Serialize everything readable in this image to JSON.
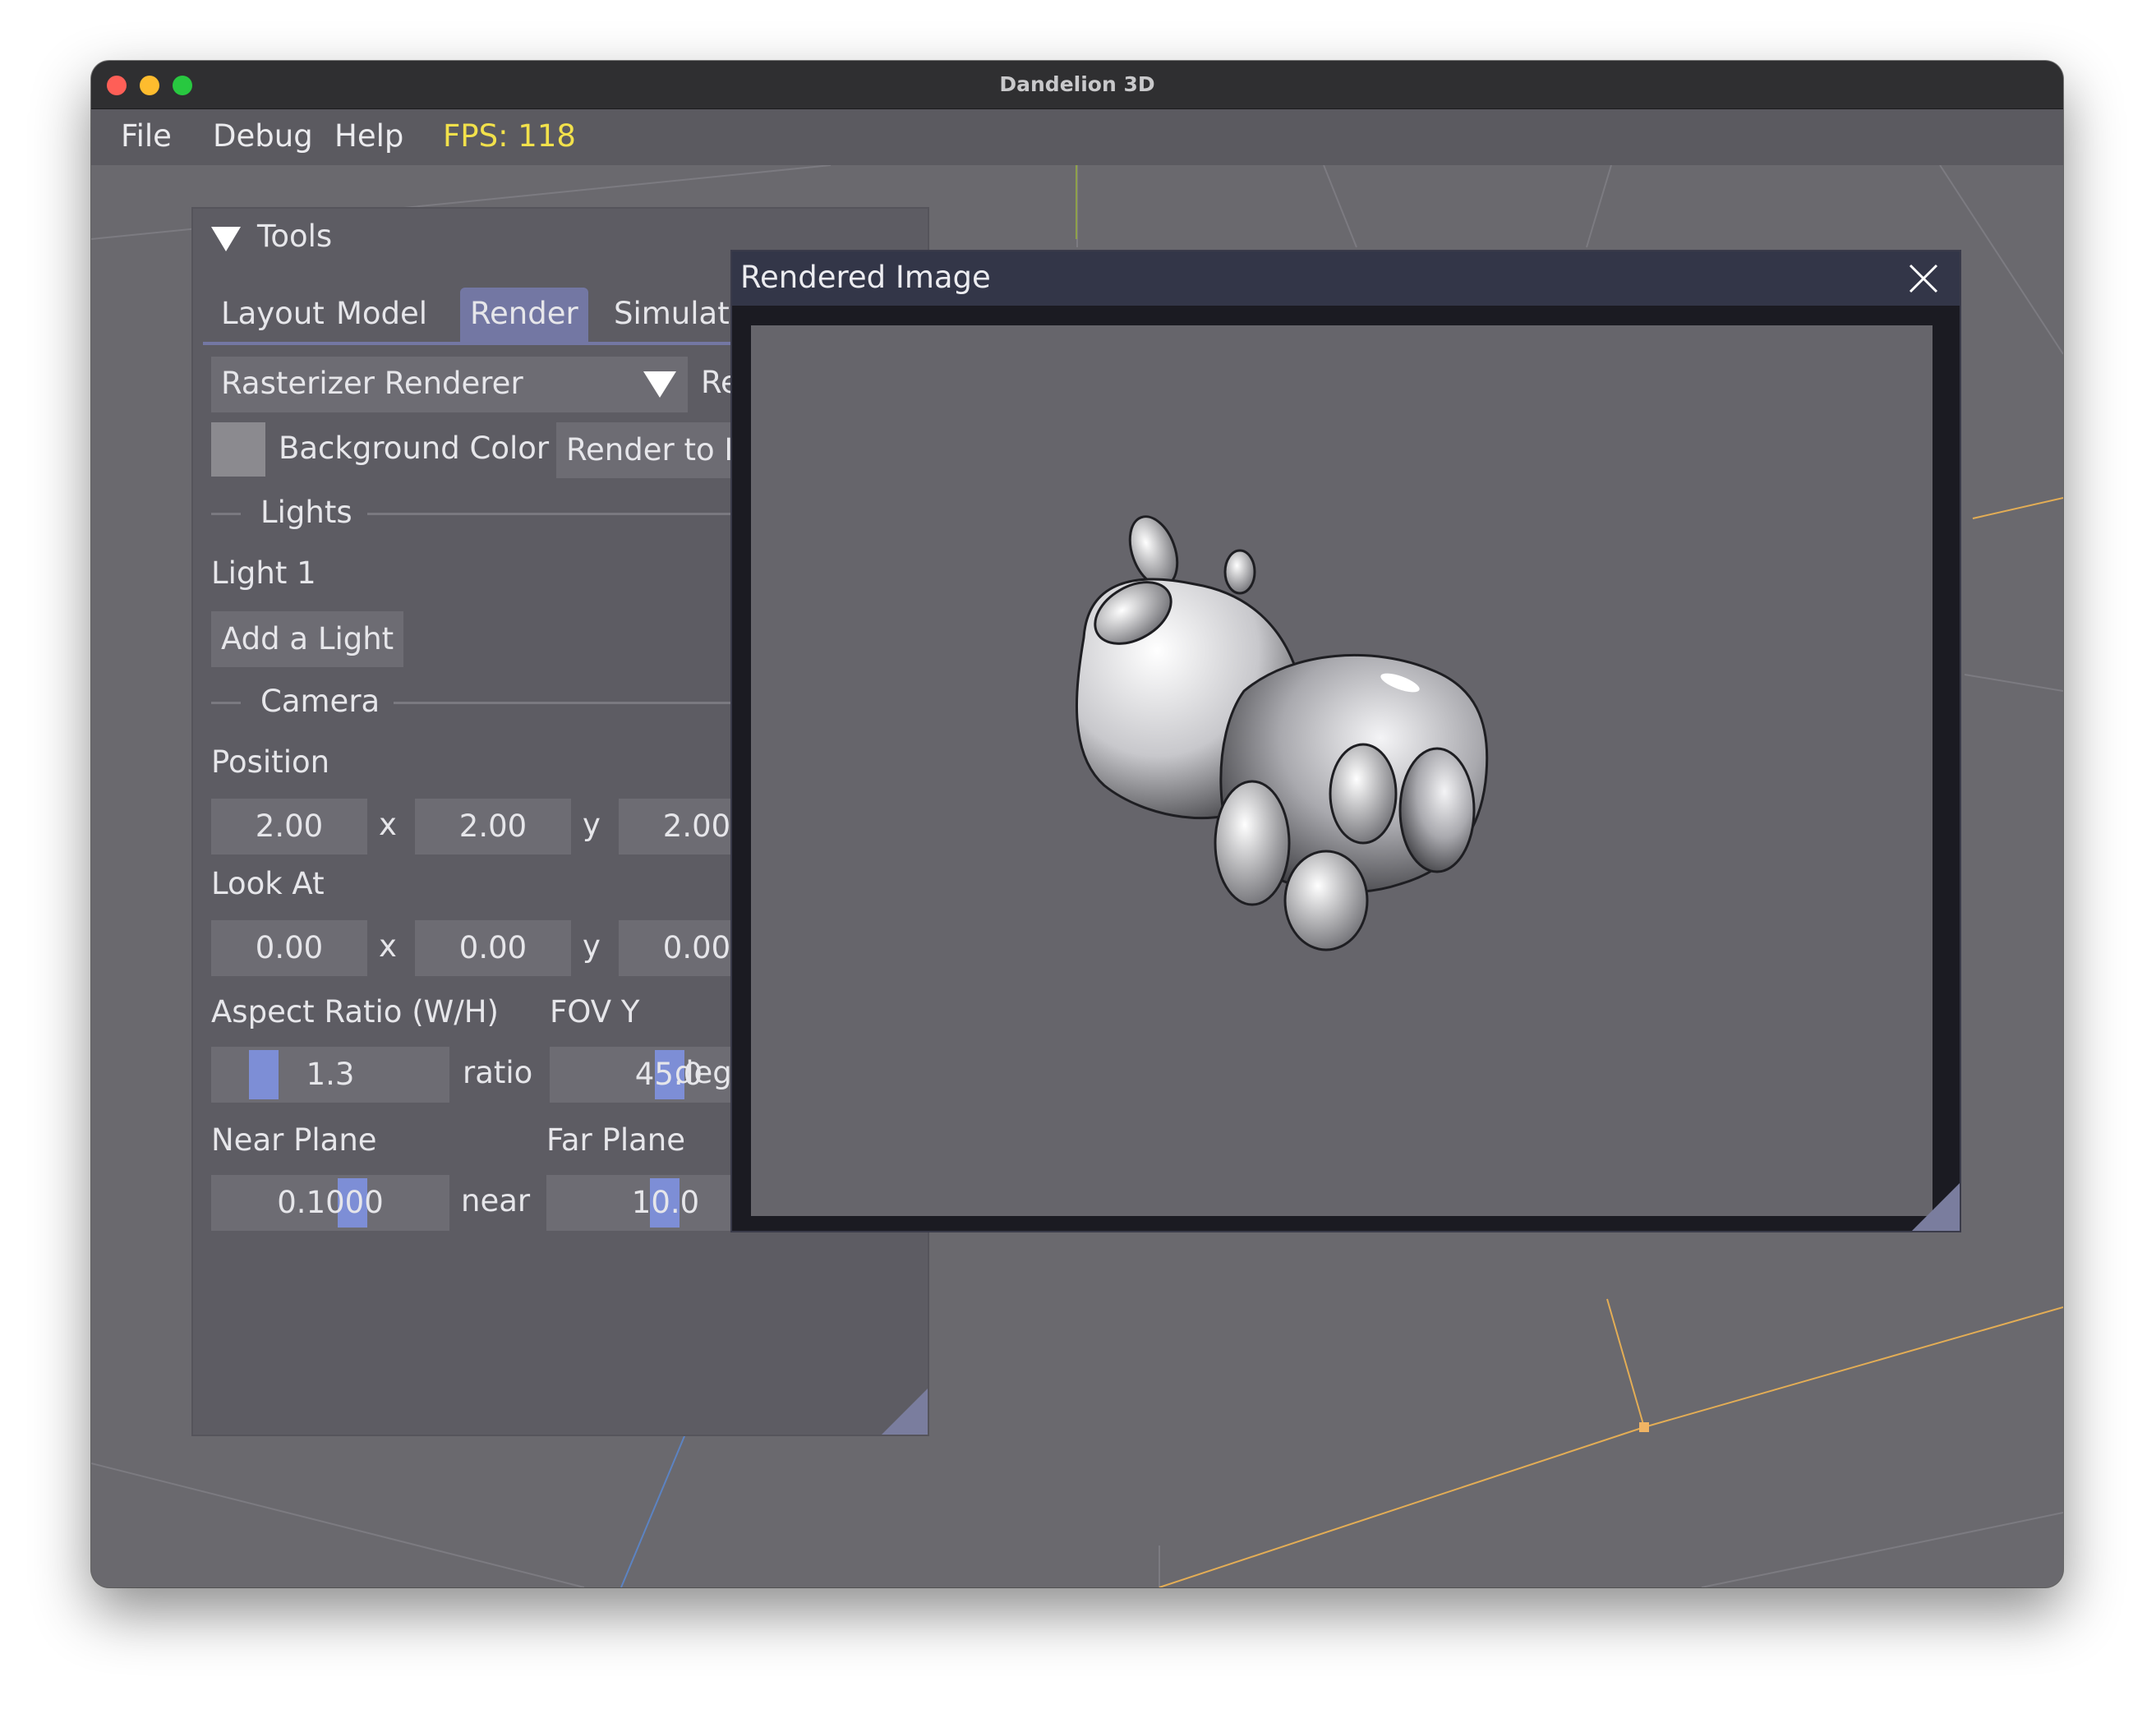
{
  "window": {
    "title": "Dandelion 3D"
  },
  "menubar": {
    "items": [
      "File",
      "Debug",
      "Help"
    ],
    "fps_text": "FPS: 118"
  },
  "tools": {
    "header": "Tools",
    "tabs": [
      "Layout",
      "Model",
      "Render",
      "Simulate"
    ],
    "active_tab": "Render",
    "renderer_select": {
      "value": "Rasterizer Renderer",
      "options_visible": [
        "Rasterizer Renderer"
      ]
    },
    "cut_off_label": "Re",
    "background_color_label": "Background Color",
    "background_color_value": "#8b8a8f",
    "render_to_image_label": "Render to Im",
    "lights_section": "Lights",
    "light_1": "Light 1",
    "add_light_label": "Add a Light",
    "camera_section": "Camera",
    "position_label": "Position",
    "position": {
      "x": "2.00",
      "y": "2.00",
      "z": "2.00",
      "x_suffix": "x",
      "y_suffix": "y"
    },
    "look_at_label": "Look At",
    "look_at": {
      "x": "0.00",
      "y": "0.00",
      "z": "0.00",
      "x_suffix": "x",
      "y_suffix": "y"
    },
    "aspect_ratio_label": "Aspect Ratio (W/H)",
    "aspect_ratio": {
      "value": "1.3",
      "suffix": "ratio"
    },
    "fov_label": "FOV Y",
    "fov": {
      "value": "45.0",
      "suffix": "deg"
    },
    "near_plane_label": "Near Plane",
    "near_plane": {
      "value": "0.1000",
      "suffix": "near"
    },
    "far_plane_label": "Far Plane",
    "far_plane": {
      "value": "10.0"
    }
  },
  "rendered_window": {
    "title": "Rendered Image"
  },
  "colors": {
    "accent": "#7377a3",
    "slider_grab": "#7d8ed6",
    "fps_text": "#f2e14b",
    "viewport_bg": "#6a696e",
    "grid_line": "#f0b464"
  }
}
